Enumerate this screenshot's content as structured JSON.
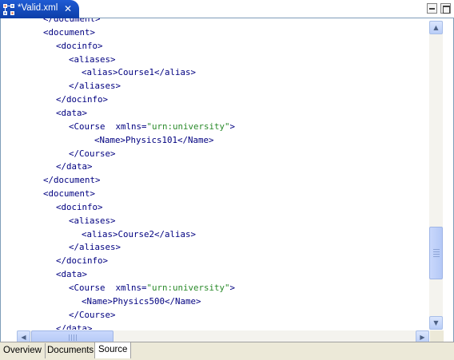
{
  "editor_tab": {
    "title": "*Valid.xml",
    "close_glyph": "✕",
    "icon": "xml-file-icon"
  },
  "window_controls": {
    "minimize_icon": "minimize-icon",
    "maximize_icon": "maximize-icon"
  },
  "code_lines": [
    {
      "text": "</document>",
      "partial": true
    },
    {
      "text": "<document>"
    },
    {
      "text": "<docinfo>"
    },
    {
      "text": "<aliases>"
    },
    {
      "text": "<alias>Course1</alias>"
    },
    {
      "text": "</aliases>"
    },
    {
      "text": "</docinfo>"
    },
    {
      "text": "<data>"
    },
    {
      "pre": "<Course  xmlns=",
      "val": "\"urn:university\"",
      "post": ">"
    },
    {
      "text": "<Name>Physics101</Name>"
    },
    {
      "text": "</Course>"
    },
    {
      "text": "</data>"
    },
    {
      "text": "</document>"
    },
    {
      "text": "<document>"
    },
    {
      "text": "<docinfo>"
    },
    {
      "text": "<aliases>"
    },
    {
      "text": "<alias>Course2</alias>"
    },
    {
      "text": "</aliases>"
    },
    {
      "text": "</docinfo>"
    },
    {
      "text": "<data>"
    },
    {
      "pre": "<Course  xmlns=",
      "val": "\"urn:university\"",
      "post": ">"
    },
    {
      "text": "<Name>Physics500</Name>"
    },
    {
      "text": "</Course>"
    },
    {
      "text": "</data>",
      "partial": true
    }
  ],
  "colors": {
    "tag": "#000080",
    "attribute_value": "#2a8a2a",
    "tab_active": "#1f5bd4"
  },
  "scrollbars": {
    "vertical_up_glyph": "▲",
    "vertical_down_glyph": "▼",
    "horizontal_left_glyph": "◀",
    "horizontal_right_glyph": "▶"
  },
  "bottom_tabs": [
    {
      "label": "Overview",
      "active": false
    },
    {
      "label": "Documents",
      "active": false
    },
    {
      "label": "Source",
      "active": true
    }
  ]
}
